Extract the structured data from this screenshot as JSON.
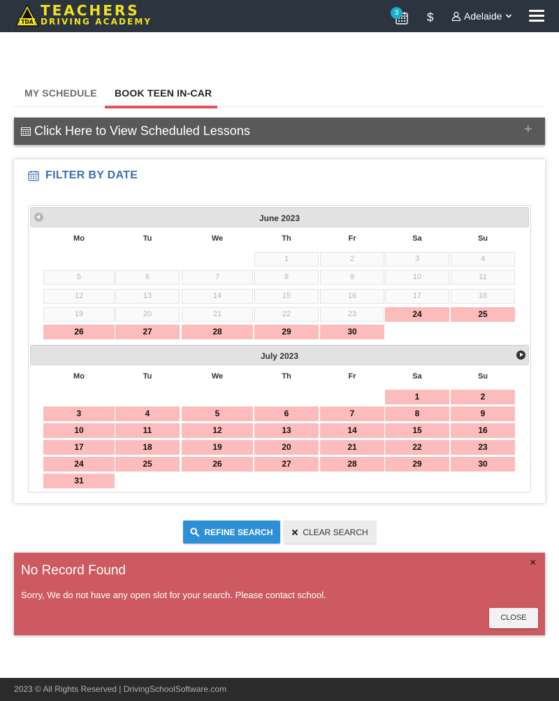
{
  "header": {
    "logo_line1": "TEACHERS",
    "logo_line2": "DRIVING ACADEMY",
    "logo_mark": "TDA",
    "notification_count": "3",
    "currency_symbol": "$",
    "user_name": "Adelaide",
    "brand_color": "#f2e21b",
    "bar_color": "#2c3440"
  },
  "tabs": [
    {
      "label": "MY SCHEDULE",
      "active": false
    },
    {
      "label": "BOOK TEEN IN-CAR",
      "active": true
    }
  ],
  "scheduled_bar": {
    "label": "Click Here to View Scheduled Lessons",
    "expand_symbol": "+"
  },
  "filter": {
    "title": "FILTER BY DATE",
    "weekdays": [
      "Mo",
      "Tu",
      "We",
      "Th",
      "Fr",
      "Sa",
      "Su"
    ],
    "months": [
      {
        "title": "June 2023",
        "rows": [
          [
            null,
            null,
            null,
            {
              "d": "1",
              "s": "dis"
            },
            {
              "d": "2",
              "s": "dis"
            },
            {
              "d": "3",
              "s": "dis"
            },
            {
              "d": "4",
              "s": "dis"
            }
          ],
          [
            {
              "d": "5",
              "s": "dis"
            },
            {
              "d": "6",
              "s": "dis"
            },
            {
              "d": "7",
              "s": "dis"
            },
            {
              "d": "8",
              "s": "dis"
            },
            {
              "d": "9",
              "s": "dis"
            },
            {
              "d": "10",
              "s": "dis"
            },
            {
              "d": "11",
              "s": "dis"
            }
          ],
          [
            {
              "d": "12",
              "s": "dis"
            },
            {
              "d": "13",
              "s": "dis"
            },
            {
              "d": "14",
              "s": "dis"
            },
            {
              "d": "15",
              "s": "dis"
            },
            {
              "d": "16",
              "s": "dis"
            },
            {
              "d": "17",
              "s": "dis"
            },
            {
              "d": "18",
              "s": "dis"
            }
          ],
          [
            {
              "d": "19",
              "s": "dis"
            },
            {
              "d": "20",
              "s": "dis"
            },
            {
              "d": "21",
              "s": "dis"
            },
            {
              "d": "22",
              "s": "dis"
            },
            {
              "d": "23",
              "s": "dis"
            },
            {
              "d": "24",
              "s": "av"
            },
            {
              "d": "25",
              "s": "av"
            }
          ],
          [
            {
              "d": "26",
              "s": "av"
            },
            {
              "d": "27",
              "s": "av"
            },
            {
              "d": "28",
              "s": "av"
            },
            {
              "d": "29",
              "s": "av"
            },
            {
              "d": "30",
              "s": "av"
            },
            null,
            null
          ]
        ]
      },
      {
        "title": "July 2023",
        "rows": [
          [
            null,
            null,
            null,
            null,
            null,
            {
              "d": "1",
              "s": "av"
            },
            {
              "d": "2",
              "s": "av"
            }
          ],
          [
            {
              "d": "3",
              "s": "av"
            },
            {
              "d": "4",
              "s": "av"
            },
            {
              "d": "5",
              "s": "av"
            },
            {
              "d": "6",
              "s": "av"
            },
            {
              "d": "7",
              "s": "av"
            },
            {
              "d": "8",
              "s": "av"
            },
            {
              "d": "9",
              "s": "av"
            }
          ],
          [
            {
              "d": "10",
              "s": "av"
            },
            {
              "d": "11",
              "s": "av"
            },
            {
              "d": "12",
              "s": "av"
            },
            {
              "d": "13",
              "s": "av"
            },
            {
              "d": "14",
              "s": "av"
            },
            {
              "d": "15",
              "s": "av"
            },
            {
              "d": "16",
              "s": "av"
            }
          ],
          [
            {
              "d": "17",
              "s": "av"
            },
            {
              "d": "18",
              "s": "av"
            },
            {
              "d": "19",
              "s": "av"
            },
            {
              "d": "20",
              "s": "av"
            },
            {
              "d": "21",
              "s": "av"
            },
            {
              "d": "22",
              "s": "av"
            },
            {
              "d": "23",
              "s": "av"
            }
          ],
          [
            {
              "d": "24",
              "s": "av"
            },
            {
              "d": "25",
              "s": "av"
            },
            {
              "d": "26",
              "s": "av"
            },
            {
              "d": "27",
              "s": "av"
            },
            {
              "d": "28",
              "s": "av"
            },
            {
              "d": "29",
              "s": "av"
            },
            {
              "d": "30",
              "s": "av"
            }
          ],
          [
            {
              "d": "31",
              "s": "av"
            },
            null,
            null,
            null,
            null,
            null,
            null
          ]
        ]
      }
    ],
    "available_color": "#fcbcbc"
  },
  "actions": {
    "refine_label": "REFINE SEARCH",
    "clear_label": "CLEAR SEARCH",
    "refine_color": "#2d8fd6"
  },
  "alert": {
    "title": "No Record Found",
    "message": "Sorry, We do not have any open slot for your search. Please contact school.",
    "close_label": "CLOSE",
    "dismiss_symbol": "×",
    "color": "#cd5a60"
  },
  "footer": {
    "text": "2023 © All Rights Reserved | DrivingSchoolSoftware.com"
  }
}
